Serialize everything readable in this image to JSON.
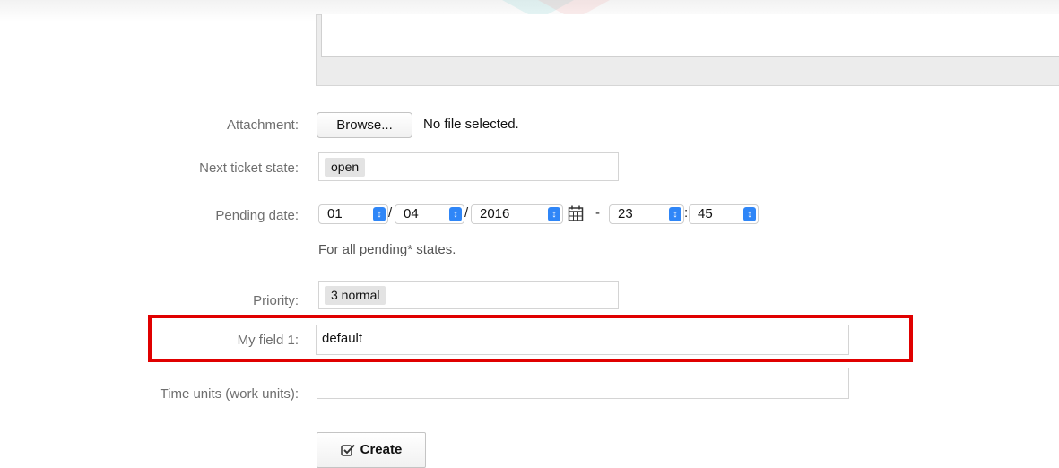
{
  "form": {
    "attachment": {
      "label": "Attachment:",
      "browse_button": "Browse...",
      "status": "No file selected."
    },
    "next_state": {
      "label": "Next ticket state:",
      "value": "open"
    },
    "pending_date": {
      "label": "Pending date:",
      "month": "01",
      "day": "04",
      "year": "2016",
      "hour": "23",
      "minute": "45",
      "sep_slash": "/",
      "sep_dash": "-",
      "sep_colon": ":",
      "hint": "For all pending* states."
    },
    "priority": {
      "label": "Priority:",
      "value": "3 normal"
    },
    "my_field": {
      "label": "My field 1:",
      "value": "default"
    },
    "time_units": {
      "label": "Time units (work units):",
      "value": ""
    },
    "create_button": "Create"
  },
  "colors": {
    "highlight": "#e00000",
    "select_arrow": "#2f86f7"
  },
  "icons": [
    "calendar-icon",
    "checkbox-check-icon",
    "select-arrows-icon"
  ]
}
